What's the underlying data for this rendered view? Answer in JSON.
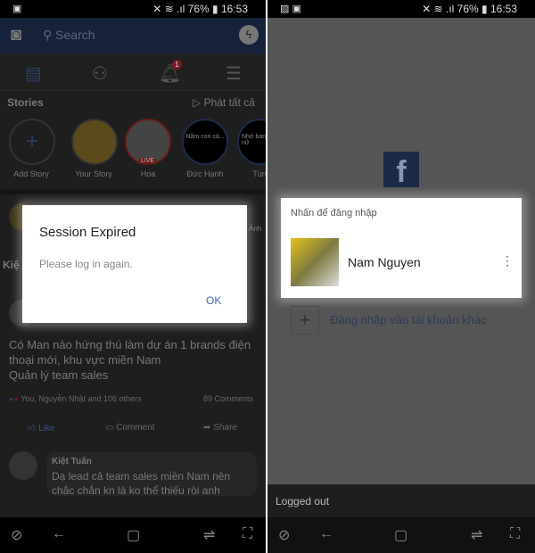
{
  "status_left": {
    "time": "16:53",
    "battery": "76%"
  },
  "status_right": {
    "time": "16:53",
    "battery": "76%"
  },
  "feed": {
    "search_placeholder": "Search",
    "stories_title": "Stories",
    "play_all": "Phát tất cả",
    "stories": [
      {
        "name": "Add Story"
      },
      {
        "name": "Your Story"
      },
      {
        "name": "Hoa",
        "badge": "LIVE"
      },
      {
        "name": "Đức Hạnh",
        "preview": "Năm con cá..."
      },
      {
        "name": "Tùn",
        "preview": "Nhớ ban nữ"
      }
    ],
    "notification_count": "1",
    "post_author_partial": "Kiệ",
    "post_text": [
      "Có Man nào hứng thú làm dự án 1 brands điện",
      "thoại mới, khu vực miền Nam",
      "Quản lý team sales"
    ],
    "reactions": "You, Nguyễn Nhật and 106 others",
    "comments_count": "89 Comments",
    "actions": {
      "like": "Like",
      "comment": "Comment",
      "share": "Share"
    },
    "comment": {
      "author": "Kiệt Tuấn",
      "text": [
        "Dạ lead cả team sales miền Nam nên",
        "chắc chắn kn là ko thể thiếu rồi anh"
      ]
    },
    "side_label": "Ảnh"
  },
  "dialog": {
    "title": "Session Expired",
    "message": "Please log in again.",
    "ok": "OK"
  },
  "login": {
    "prompt": "Nhấn để đăng nhập",
    "account_name": "Nam Nguyen",
    "add_account": "Đăng nhập vào tài khoản khác",
    "snackbar": "Logged out"
  },
  "colors": {
    "facebook_blue": "#3b5998",
    "dialog_button": "#4267b2"
  }
}
